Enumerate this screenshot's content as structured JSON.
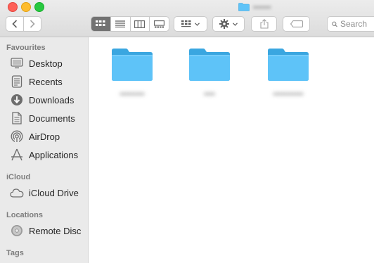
{
  "window": {
    "title": "▪▪▪▪▪▪"
  },
  "toolbar": {
    "search_placeholder": "Search"
  },
  "sidebar": {
    "favourites_header": "Favourites",
    "favourites": [
      {
        "label": "Desktop",
        "icon": "desktop-icon"
      },
      {
        "label": "Recents",
        "icon": "recents-icon"
      },
      {
        "label": "Downloads",
        "icon": "downloads-icon"
      },
      {
        "label": "Documents",
        "icon": "documents-icon"
      },
      {
        "label": "AirDrop",
        "icon": "airdrop-icon"
      },
      {
        "label": "Applications",
        "icon": "applications-icon"
      }
    ],
    "icloud_header": "iCloud",
    "icloud": [
      {
        "label": "iCloud Drive",
        "icon": "cloud-icon"
      }
    ],
    "locations_header": "Locations",
    "locations": [
      {
        "label": "Remote Disc",
        "icon": "disc-icon"
      }
    ],
    "tags_header": "Tags"
  },
  "content": {
    "items": [
      {
        "name": "▪▪▪▪▪▪▪▪▪",
        "icon": "folder-icon"
      },
      {
        "name": "▪▪▪▪",
        "icon": "folder-icon"
      },
      {
        "name": "▪▪▪▪▪▪▪▪▪▪▪",
        "icon": "folder-icon"
      }
    ]
  },
  "colors": {
    "folder_blue": "#5ec3f8",
    "sidebar_bg": "#eaeaea",
    "toolbar_bg": "#e3e3e3",
    "active_view": "#727272"
  }
}
